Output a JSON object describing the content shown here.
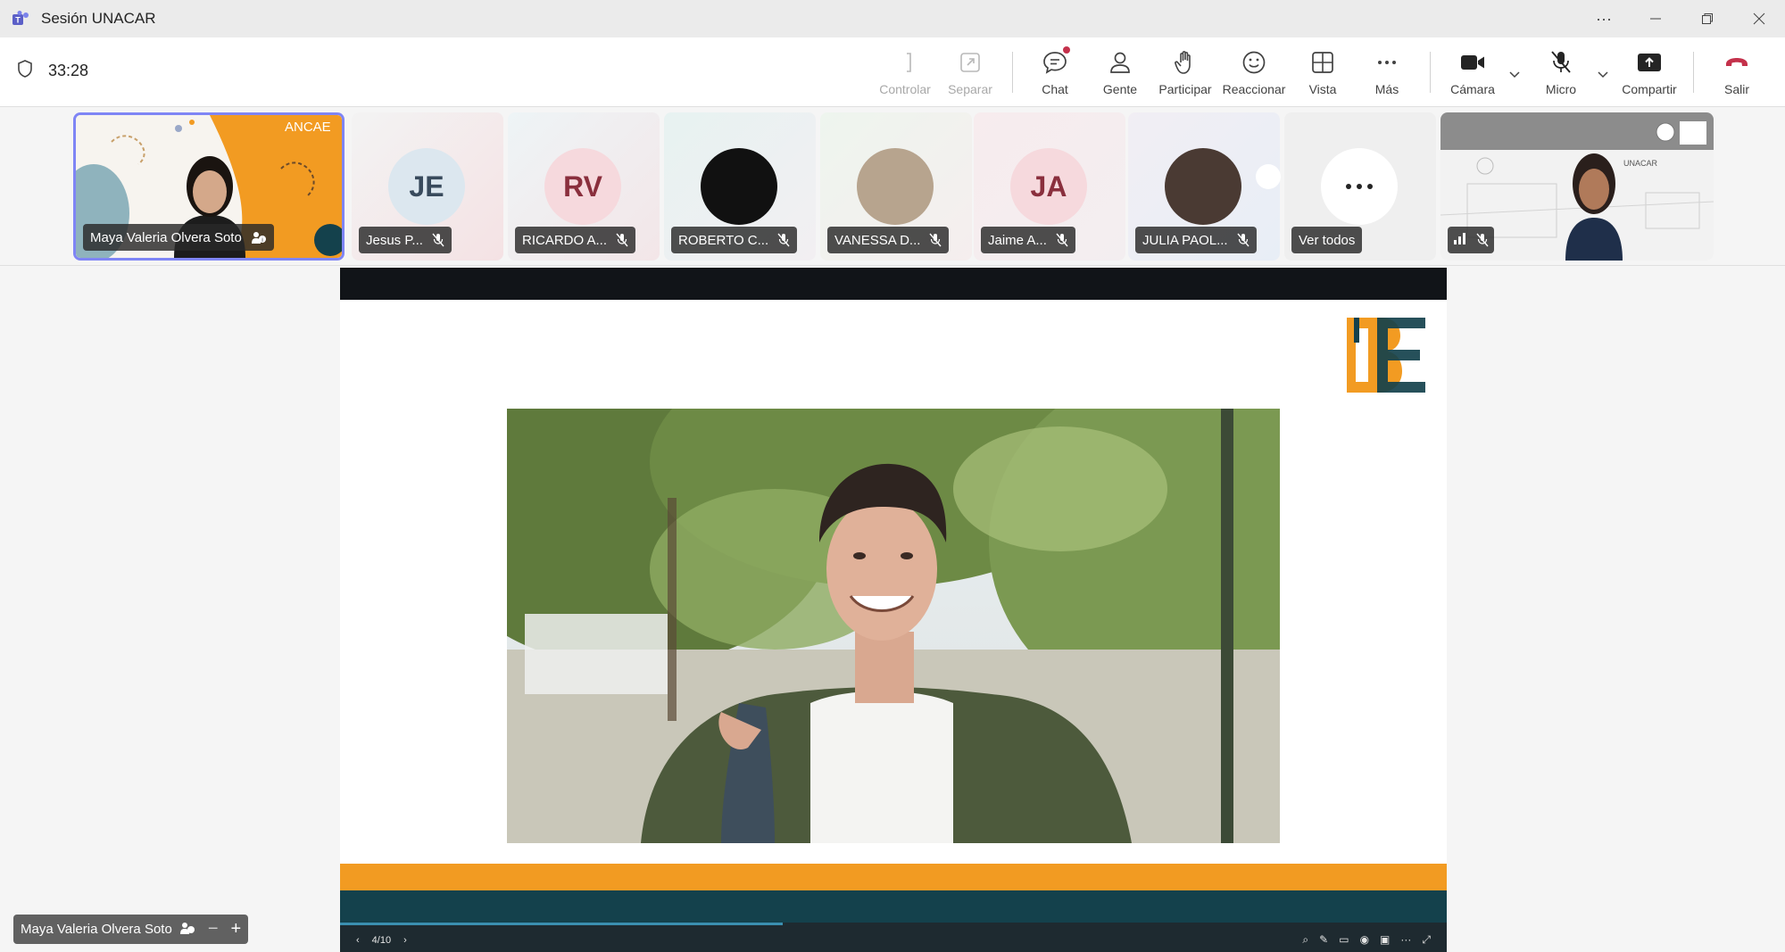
{
  "window": {
    "title": "Sesión UNACAR"
  },
  "toolbar": {
    "timer": "33:28",
    "buttons": {
      "controlar": "Controlar",
      "separar": "Separar",
      "chat": "Chat",
      "gente": "Gente",
      "participar": "Participar",
      "reaccionar": "Reaccionar",
      "vista": "Vista",
      "mas": "Más",
      "camara": "Cámara",
      "micro": "Micro",
      "compartir": "Compartir",
      "salir": "Salir"
    }
  },
  "participants": {
    "main": {
      "name": "Maya Valeria Olvera Soto",
      "background_text": "ANCAE"
    },
    "list": [
      {
        "initials": "JE",
        "name": "Jesus P...",
        "color": "#dce7ef",
        "text_color": "#384a5c"
      },
      {
        "initials": "RV",
        "name": "RICARDO A...",
        "color": "#f6d9dd",
        "text_color": "#8a2f3d"
      },
      {
        "initials": "",
        "name": "ROBERTO C...",
        "color": "#111111",
        "text_color": "#ffffff"
      },
      {
        "initials": "",
        "name": "VANESSA D...",
        "color": "#b7a48e",
        "text_color": "#ffffff"
      },
      {
        "initials": "JA",
        "name": "Jaime A...",
        "color": "#f6d9dd",
        "text_color": "#8a2f3d"
      },
      {
        "initials": "",
        "name": "JULIA PAOL...",
        "color": "#4a3a33",
        "text_color": "#ffffff"
      }
    ],
    "see_all": "Ver todos",
    "last_tile_text": "UNACAR"
  },
  "presentation": {
    "page": "4/10",
    "logo_letters": "BE"
  },
  "self_view": {
    "name": "Maya Valeria Olvera Soto"
  },
  "colors": {
    "accent": "#7f85f5",
    "leave": "#c4314b",
    "orange": "#f29b22",
    "teal": "#14414c"
  }
}
